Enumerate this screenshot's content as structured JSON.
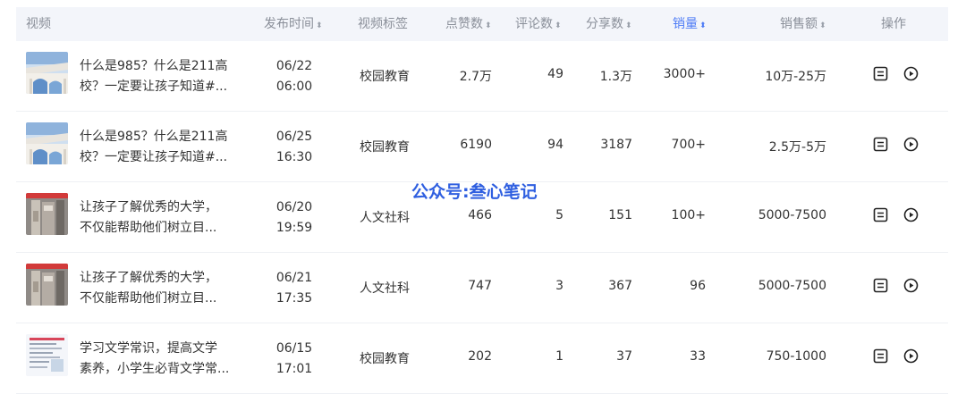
{
  "header": {
    "video": "视频",
    "publish_time": "发布时间",
    "video_tag": "视频标签",
    "likes": "点赞数",
    "comments": "评论数",
    "shares": "分享数",
    "sales_volume": "销量",
    "sales_amount": "销售额",
    "actions": "操作",
    "sort_glyph": "⬍"
  },
  "rows": [
    {
      "title_line1": "什么是985？什么是211高",
      "title_line2": "校？一定要让孩子知道#...",
      "date": "06/22",
      "time": "06:00",
      "tag": "校园教育",
      "likes": "2.7万",
      "comments": "49",
      "shares": "1.3万",
      "sales": "3000+",
      "amount": "10万-25万",
      "thumb": "building"
    },
    {
      "title_line1": "什么是985？什么是211高",
      "title_line2": "校？一定要让孩子知道#...",
      "date": "06/25",
      "time": "16:30",
      "tag": "校园教育",
      "likes": "6190",
      "comments": "94",
      "shares": "3187",
      "sales": "700+",
      "amount": "2.5万-5万",
      "thumb": "building"
    },
    {
      "title_line1": "让孩子了解优秀的大学，",
      "title_line2": "不仅能帮助他们树立目...",
      "date": "06/20",
      "time": "19:59",
      "tag": "人文社科",
      "likes": "466",
      "comments": "5",
      "shares": "151",
      "sales": "100+",
      "amount": "5000-7500",
      "thumb": "book"
    },
    {
      "title_line1": "让孩子了解优秀的大学，",
      "title_line2": "不仅能帮助他们树立目...",
      "date": "06/21",
      "time": "17:35",
      "tag": "人文社科",
      "likes": "747",
      "comments": "3",
      "shares": "367",
      "sales": "96",
      "amount": "5000-7500",
      "thumb": "book"
    },
    {
      "title_line1": "学习文学常识，提高文学",
      "title_line2": "素养，小学生必背文学常...",
      "date": "06/15",
      "time": "17:01",
      "tag": "校园教育",
      "likes": "202",
      "comments": "1",
      "shares": "37",
      "sales": "33",
      "amount": "750-1000",
      "thumb": "page"
    }
  ],
  "watermark": "公众号:叁心笔记",
  "colors": {
    "accent": "#4e7cf6",
    "header_bg": "#f3f5fa",
    "watermark": "#2f5fe0"
  },
  "icons": {
    "detail": "list-detail-icon",
    "play": "play-circle-icon"
  }
}
